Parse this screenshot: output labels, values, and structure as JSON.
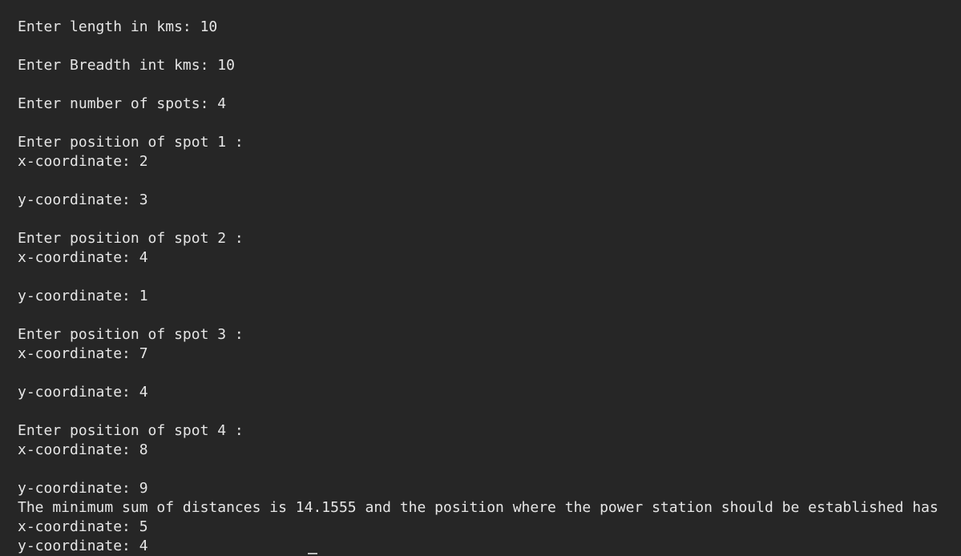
{
  "terminal": {
    "lines": [
      "Enter length in kms: 10",
      "",
      "Enter Breadth int kms: 10",
      "",
      "Enter number of spots: 4",
      "",
      "Enter position of spot 1 :",
      "x-coordinate: 2",
      "",
      "y-coordinate: 3",
      "",
      "Enter position of spot 2 :",
      "x-coordinate: 4",
      "",
      "y-coordinate: 1",
      "",
      "Enter position of spot 3 :",
      "x-coordinate: 7",
      "",
      "y-coordinate: 4",
      "",
      "Enter position of spot 4 :",
      "x-coordinate: 8",
      "",
      "y-coordinate: 9",
      "The minimum sum of distances is 14.1555 and the position where the power station should be established has",
      "x-coordinate: 5",
      "y-coordinate: 4"
    ]
  }
}
